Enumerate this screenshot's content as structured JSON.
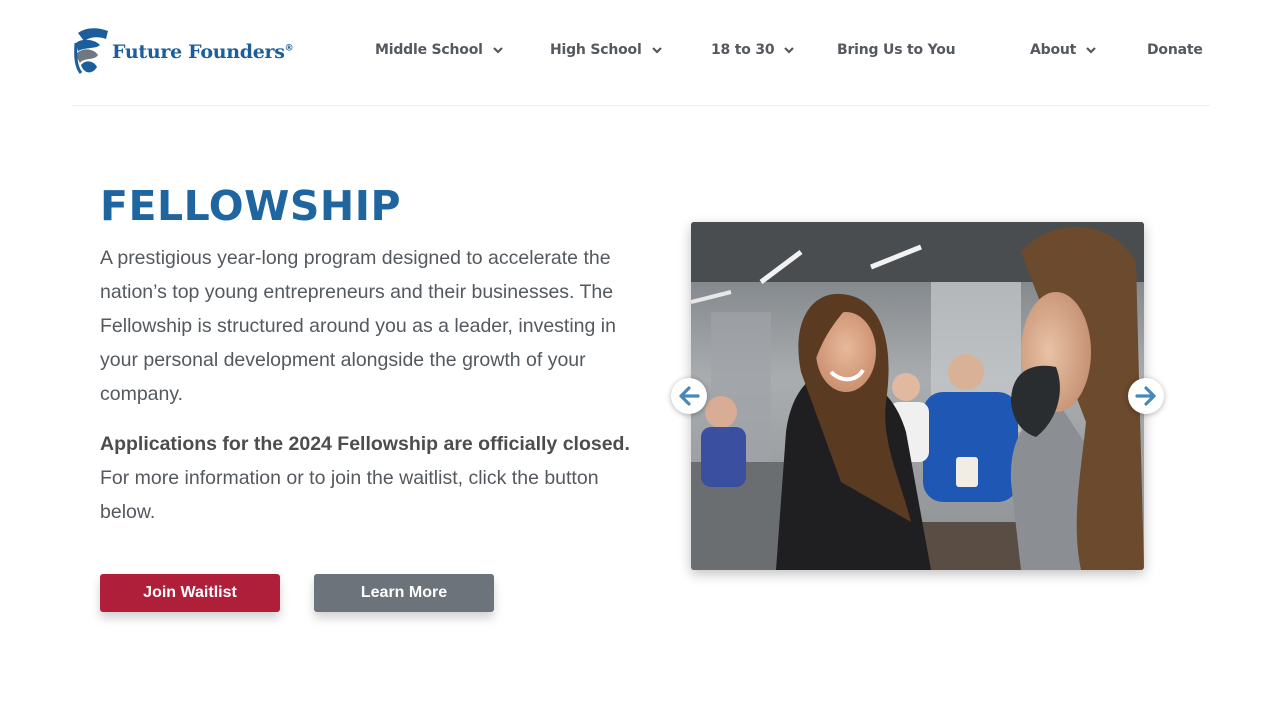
{
  "logo": {
    "text": "Future Founders",
    "reg_mark": "®"
  },
  "nav": {
    "middle_school": "Middle School",
    "high_school": "High School",
    "eighteen_to_thirty": "18 to 30",
    "bring_us": "Bring Us to You",
    "about": "About",
    "donate": "Donate"
  },
  "main": {
    "title": "FELLOWSHIP",
    "paragraph1": "A prestigious year-long program designed to accelerate the nation’s top young entrepreneurs and their businesses. The Fellowship is structured around you as a leader, investing in your personal development alongside the growth of your company.",
    "paragraph2_bold": "Applications for the 2024 Fellowship are officially closed.",
    "paragraph2_rest": " For more information or to join the waitlist, click the button below.",
    "join_waitlist": "Join Waitlist",
    "learn_more": "Learn More"
  },
  "colors": {
    "brand_blue": "#1f66a1",
    "text_gray": "#54595f",
    "waitlist_red": "#b01f3a",
    "learn_gray": "#6c737b"
  },
  "icons": {
    "logo": "flag-swirl-logo-icon",
    "dropdown": "chevron-down-icon",
    "prev": "arrow-left-icon",
    "next": "arrow-right-icon"
  }
}
